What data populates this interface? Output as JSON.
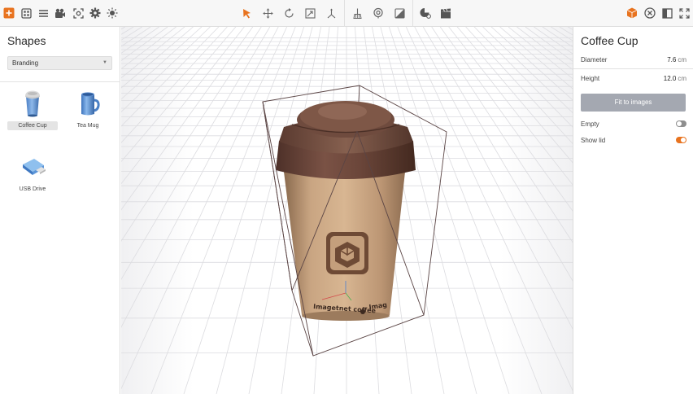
{
  "toolbar": {
    "left_icons": [
      "add-icon",
      "grid-icon",
      "list-icon",
      "camera-icon",
      "focus-icon",
      "settings-icon",
      "light-icon"
    ],
    "center_icons": [
      "select-arrow-icon",
      "move-icon",
      "rotate-icon",
      "scale-icon",
      "transform-axes-icon",
      "broom-icon",
      "target-icon",
      "material-icon",
      "render-icon",
      "clapper-icon"
    ],
    "right_icons": [
      "cube-icon",
      "close-circle-icon",
      "panel-icon",
      "expand-icon"
    ],
    "accent": "#e8731f"
  },
  "shapes_panel": {
    "title": "Shapes",
    "category": "Branding",
    "items": [
      {
        "label": "Coffee Cup",
        "icon": "coffee-cup-icon",
        "selected": true
      },
      {
        "label": "Tea Mug",
        "icon": "tea-mug-icon",
        "selected": false
      },
      {
        "label": "USB Drive",
        "icon": "usb-drive-icon",
        "selected": false
      }
    ]
  },
  "viewport": {
    "cup_brand_text_left": "Imagetnet coffee",
    "cup_brand_text_right": "Imag"
  },
  "properties": {
    "title": "Coffee Cup",
    "diameter": {
      "label": "Diameter",
      "value": "7.6",
      "unit": "cm"
    },
    "height": {
      "label": "Height",
      "value": "12.0",
      "unit": "cm"
    },
    "fit_button": "Fit to images",
    "empty": {
      "label": "Empty",
      "on": false
    },
    "show_lid": {
      "label": "Show lid",
      "on": true
    }
  }
}
